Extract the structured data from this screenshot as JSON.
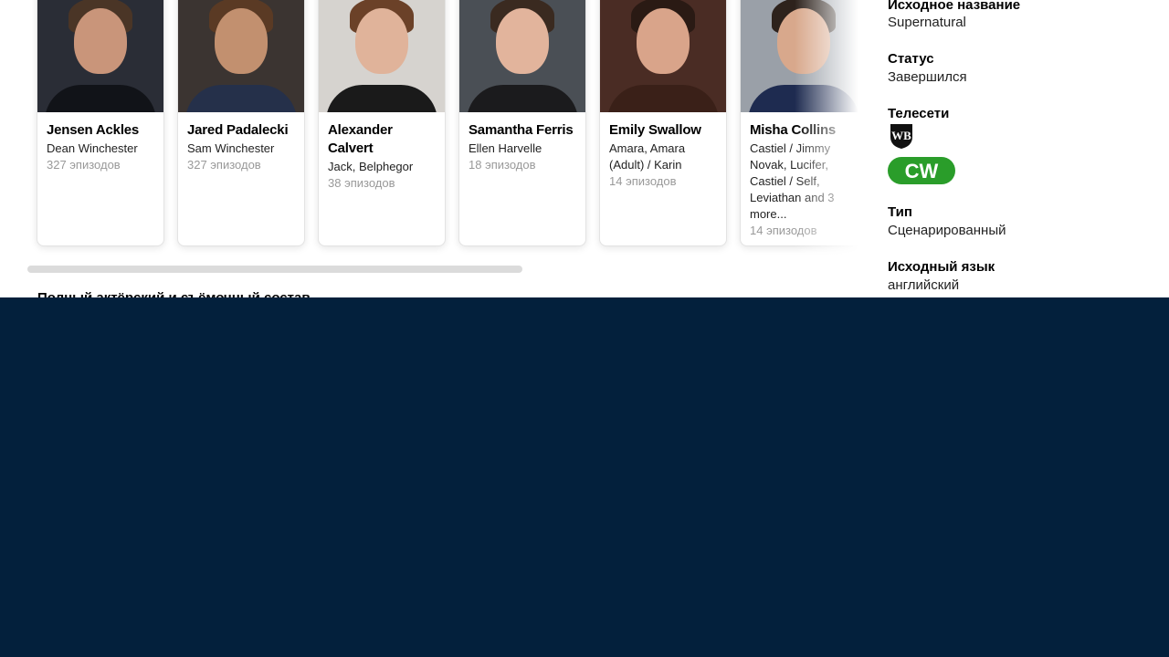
{
  "cast": [
    {
      "name": "Jensen Ackles",
      "character": "Dean Winchester",
      "episodes": "327 эпизодов",
      "colors": {
        "bg": "#2a2d36",
        "skin": "#c9957a",
        "hair": "#4a3526",
        "shirt": "#111318"
      }
    },
    {
      "name": "Jared Padalecki",
      "character": "Sam Winchester",
      "episodes": "327 эпизодов",
      "colors": {
        "bg": "#3b3431",
        "skin": "#c2906f",
        "hair": "#5a3a24",
        "shirt": "#25304a"
      }
    },
    {
      "name": "Alexander Calvert",
      "character": "Jack, Belphegor",
      "episodes": "38 эпизодов",
      "colors": {
        "bg": "#d6d3cf",
        "skin": "#e0b39a",
        "hair": "#6b4128",
        "shirt": "#1a1a1a"
      }
    },
    {
      "name": "Samantha Ferris",
      "character": "Ellen Harvelle",
      "episodes": "18 эпизодов",
      "colors": {
        "bg": "#4a4f55",
        "skin": "#e2b49c",
        "hair": "#3a2a20",
        "shirt": "#1b1b1d"
      }
    },
    {
      "name": "Emily Swallow",
      "character": "Amara, Amara (Adult) / Karin",
      "episodes": "14 эпизодов",
      "colors": {
        "bg": "#4a2c24",
        "skin": "#d9a48a",
        "hair": "#2a1a14",
        "shirt": "#3a2018"
      }
    },
    {
      "name": "Misha Collins",
      "character": "Castiel / Jimmy Novak, Lucifer, Castiel / Self, Leviathan and 3 more...",
      "episodes": "14 эпизодов",
      "colors": {
        "bg": "#9aa0a8",
        "skin": "#d8a88c",
        "hair": "#2d221c",
        "shirt": "#1e2b50"
      }
    }
  ],
  "truncated_heading": "Полный актёрский и съёмочный состав",
  "facts": {
    "original_title_label": "Исходное название",
    "original_title": "Supernatural",
    "status_label": "Статус",
    "status": "Завершился",
    "networks_label": "Телесети",
    "networks": [
      {
        "name": "The WB",
        "icon": "wb-logo-icon",
        "color": "#111111"
      },
      {
        "name": "The CW",
        "icon": "cw-logo-icon",
        "color": "#2a9d2a"
      }
    ],
    "type_label": "Тип",
    "type": "Сценарированный",
    "language_label": "Исходный язык",
    "language": "английский"
  },
  "colors": {
    "page_bg": "#03203c",
    "content_bg": "#ffffff",
    "scrollbar": "#dbdbdb"
  }
}
